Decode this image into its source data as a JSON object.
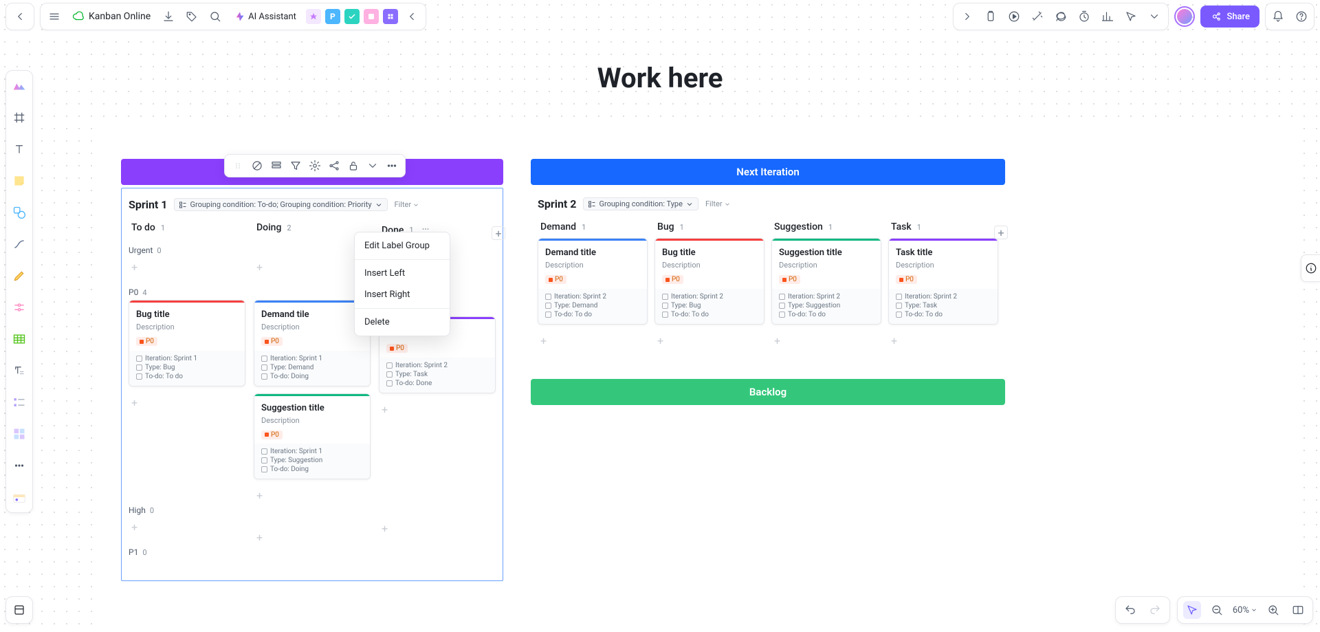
{
  "doc_title": "Kanban Online",
  "ai_label": "AI Assistant",
  "share_label": "Share",
  "page_heading": "Work here",
  "zoom": "60%",
  "app_badges": [
    {
      "label": "",
      "bg": "#f3e8ff"
    },
    {
      "label": "P",
      "bg": "#4cb6ff"
    },
    {
      "label": "",
      "bg": "#2bd4c0"
    },
    {
      "label": "",
      "bg": "#ffb1e1"
    },
    {
      "label": "",
      "bg": "#8a6cff"
    }
  ],
  "context_menu": {
    "items": [
      "Edit Label Group",
      "Insert Left",
      "Insert Right",
      "Delete"
    ]
  },
  "float_toolbar": [
    "drag",
    "color",
    "layout",
    "filter",
    "settings",
    "share",
    "lock",
    "caret",
    "more"
  ],
  "backlog_label": "Backlog",
  "next_iteration_label": "Next Iteration",
  "sprint1": {
    "name": "Sprint 1",
    "grouping_chip": "Grouping condition: To-do; Grouping condition: Priority",
    "filter_label": "Filter",
    "columns": [
      {
        "name": "To do",
        "count": 1
      },
      {
        "name": "Doing",
        "count": 2
      },
      {
        "name": "Done",
        "count": 1
      }
    ],
    "subgroups": [
      {
        "label": "Urgent",
        "count": 0
      },
      {
        "label": "P0",
        "count": 4
      },
      {
        "label": "High",
        "count": 0
      },
      {
        "label": "P1",
        "count": 0
      }
    ],
    "cards": {
      "todo_p0": {
        "title": "Bug title",
        "desc": "Description",
        "prio": "P0",
        "stripe": "stripe-red",
        "meta": [
          "Iteration: Sprint 1",
          "Type: Bug",
          "To-do: To do"
        ]
      },
      "doing_p0_a": {
        "title": "Demand tile",
        "desc": "Description",
        "prio": "P0",
        "stripe": "stripe-blue",
        "meta": [
          "Iteration: Sprint 1",
          "Type: Demand",
          "To-do: Doing"
        ]
      },
      "doing_p0_b": {
        "title": "Suggestion title",
        "desc": "Description",
        "prio": "P0",
        "stripe": "stripe-green",
        "meta": [
          "Iteration: Sprint 1",
          "Type: Suggestion",
          "To-do: Doing"
        ]
      },
      "done_p0": {
        "title": "",
        "desc": "",
        "prio": "P0",
        "stripe": "stripe-purple",
        "meta": [
          "Iteration: Sprint 2",
          "Type: Task",
          "To-do: Done"
        ]
      }
    }
  },
  "sprint2": {
    "name": "Sprint 2",
    "grouping_chip": "Grouping condition: Type",
    "filter_label": "Filter",
    "columns": [
      {
        "name": "Demand",
        "count": 1,
        "stripe": "stripe-blue"
      },
      {
        "name": "Bug",
        "count": 1,
        "stripe": "stripe-red"
      },
      {
        "name": "Suggestion",
        "count": 1,
        "stripe": "stripe-green"
      },
      {
        "name": "Task",
        "count": 1,
        "stripe": "stripe-purple"
      }
    ],
    "cards": [
      {
        "title": "Demand title",
        "desc": "Description",
        "prio": "P0",
        "stripe": "stripe-blue",
        "meta": [
          "Iteration: Sprint 2",
          "Type: Demand",
          "To-do: To do"
        ]
      },
      {
        "title": "Bug title",
        "desc": "Description",
        "prio": "P0",
        "stripe": "stripe-red",
        "meta": [
          "Iteration: Sprint 2",
          "Type: Bug",
          "To-do: To do"
        ]
      },
      {
        "title": "Suggestion title",
        "desc": "Description",
        "prio": "P0",
        "stripe": "stripe-green",
        "meta": [
          "Iteration: Sprint 2",
          "Type: Suggestion",
          "To-do: To do"
        ]
      },
      {
        "title": "Task title",
        "desc": "Description",
        "prio": "P0",
        "stripe": "stripe-purple",
        "meta": [
          "Iteration: Sprint 2",
          "Type: Task",
          "To-do: To do"
        ]
      }
    ]
  }
}
